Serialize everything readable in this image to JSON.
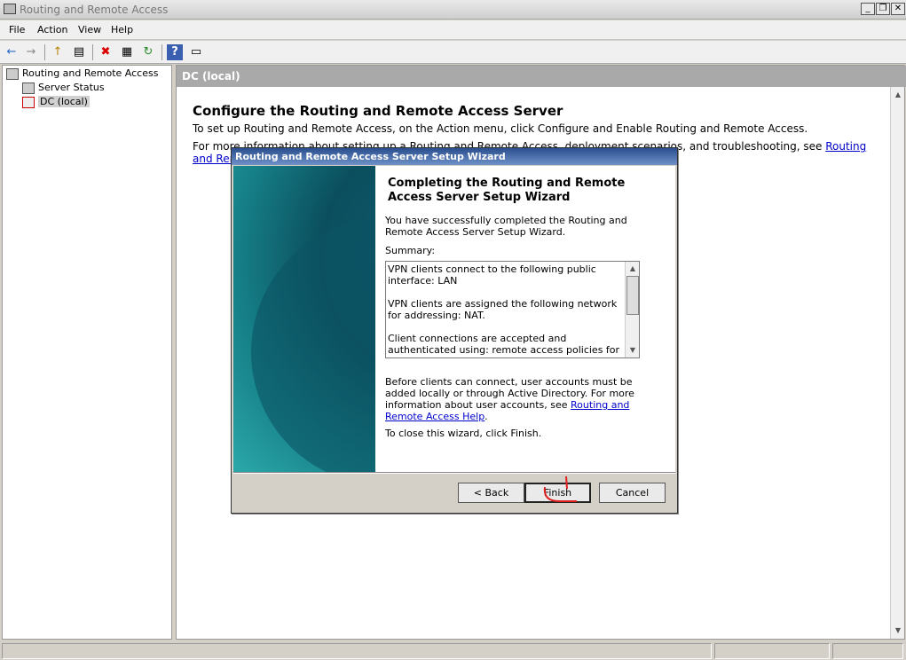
{
  "window": {
    "title": "Routing and Remote Access",
    "minimize": "_",
    "restore": "❐",
    "close": "✕"
  },
  "menu": {
    "items": [
      "File",
      "Action",
      "View",
      "Help"
    ]
  },
  "toolbar": {
    "back": "←",
    "forward": "→",
    "up": "↑",
    "show_tree": "▤",
    "delete": "✖",
    "properties": "▦",
    "refresh": "↻",
    "help": "?",
    "console": "▭"
  },
  "tree": {
    "root": "Routing and Remote Access",
    "server_status": "Server Status",
    "dc_local": "DC (local)"
  },
  "main": {
    "header": "DC (local)",
    "title": "Configure the Routing and Remote Access Server",
    "line1": "To set up Routing and Remote Access, on the Action menu, click Configure and Enable Routing and Remote Access.",
    "line2_text": "For more information about setting up a Routing and Remote Access, deployment scenarios, and troubleshooting, see ",
    "line2_link": "Routing and Remote"
  },
  "wizard": {
    "title": "Routing and Remote Access Server Setup Wizard",
    "heading": "Completing the Routing and Remote Access Server Setup Wizard",
    "intro": "You have successfully completed the Routing and Remote Access Server Setup Wizard.",
    "summary_label": "Summary:",
    "summary": [
      "VPN clients connect to the following public interface: LAN",
      "VPN clients are assigned the following network for addressing: NAT.",
      "Client connections are accepted and authenticated using: remote access policies for this server."
    ],
    "note_text": "Before clients can connect, user accounts must be added locally or through Active Directory. For more information about user accounts, see ",
    "note_link": "Routing and Remote Access Help",
    "note_end": ".",
    "close_text": "To close this wizard, click Finish.",
    "buttons": {
      "back": "< Back",
      "finish": "Finish",
      "cancel": "Cancel"
    }
  },
  "colors": {
    "title_bar": "#2a4f8f",
    "link": "#0000cc",
    "side_panel": "#0e5a6e"
  }
}
